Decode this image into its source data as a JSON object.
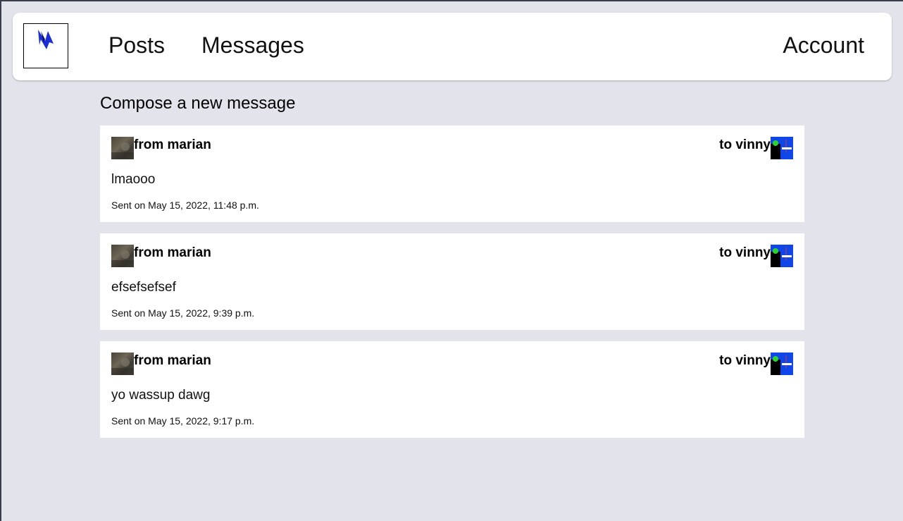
{
  "navbar": {
    "logo_icon": "lightning-bolt-logo",
    "posts_label": "Posts",
    "messages_label": "Messages",
    "account_label": "Account"
  },
  "page": {
    "title": "Compose a new message"
  },
  "messages": [
    {
      "from": "from marian",
      "to": "to vinny",
      "body": "lmaooo",
      "sent": "Sent on May 15, 2022, 11:48 p.m."
    },
    {
      "from": "from marian",
      "to": "to vinny",
      "body": "efsefsefsef",
      "sent": "Sent on May 15, 2022, 9:39 p.m."
    },
    {
      "from": "from marian",
      "to": "to vinny",
      "body": "yo wassup dawg",
      "sent": "Sent on May 15, 2022, 9:17 p.m."
    }
  ],
  "colors": {
    "background": "#e3e3eb",
    "card": "#ffffff",
    "logo_blue": "#1a2fd6",
    "to_avatar_blue": "#1045e8"
  }
}
